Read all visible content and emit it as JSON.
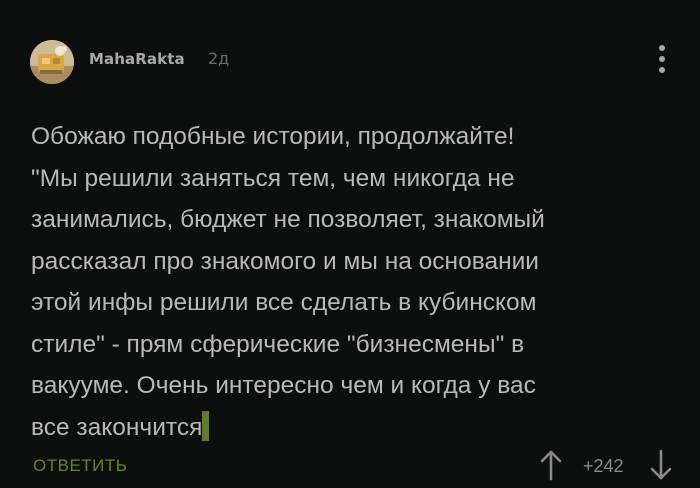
{
  "comment": {
    "author": "MahaRakta",
    "time": "2д",
    "text": "Обожаю подобные истории, продолжайте!\n\"Мы решили заняться тем, чем никогда не\nзанимались, бюджет не позволяет, знакомый\nрассказал про знакомого и мы на основании\nэтой инфы решили все сделать в кубинском\nстиле\" - прям сферические \"бизнесмены\" в\nвакууме. Очень интересно чем и когда у вас\nвсе закончится",
    "reply_label": "ОТВЕТИТЬ",
    "rating": "+242"
  },
  "icons": {
    "more": "more-vertical-icon",
    "up": "arrow-up-icon",
    "down": "arrow-down-icon"
  },
  "colors": {
    "background": "#0d0e0e",
    "text": "#b9b9b9",
    "accent": "#5f8a2b"
  }
}
